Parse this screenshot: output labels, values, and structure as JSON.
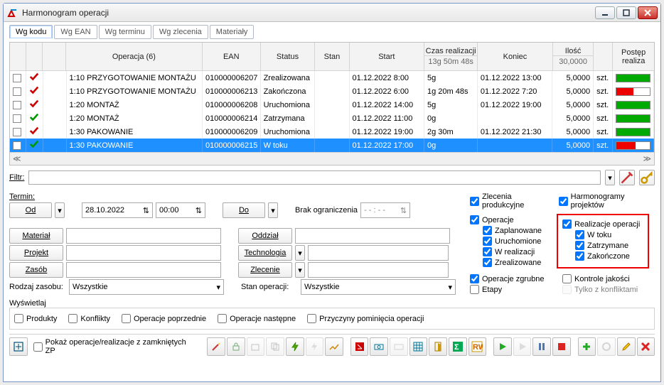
{
  "window": {
    "title": "Harmonogram operacji"
  },
  "tabs": [
    "Wg kodu",
    "Wg EAN",
    "Wg terminu",
    "Wg zlecenia",
    "Materiały"
  ],
  "grid": {
    "columns": {
      "operacja": "Operacja (6)",
      "ean": "EAN",
      "status": "Status",
      "stan": "Stan",
      "start": "Start",
      "czas": "Czas realizacji",
      "czas_sub": "13g 50m 48s",
      "koniec": "Koniec",
      "ilosc": "Ilość",
      "ilosc_sub": "30,0000",
      "postep": "Postęp realiza"
    },
    "rows": [
      {
        "op": "1:10 PRZYGOTOWANIE MONTAŻU",
        "ean": "010000006207",
        "status": "Zrealizowana",
        "stan": "",
        "start": "01.12.2022 8:00",
        "czas": "5g",
        "koniec": "01.12.2022 13:00",
        "il": "5,0000",
        "szt": "szt.",
        "bar": "green",
        "s": "r"
      },
      {
        "op": "1:10 PRZYGOTOWANIE MONTAŻU",
        "ean": "010000006213",
        "status": "Zakończona",
        "stan": "",
        "start": "01.12.2022 6:00",
        "czas": "1g 20m 48s",
        "koniec": "01.12.2022 7:20",
        "il": "5,0000",
        "szt": "szt.",
        "bar": "red",
        "s": "r"
      },
      {
        "op": "1:20 MONTAŻ",
        "ean": "010000006208",
        "status": "Uruchomiona",
        "stan": "",
        "start": "01.12.2022 14:00",
        "czas": "5g",
        "koniec": "01.12.2022 19:00",
        "il": "5,0000",
        "szt": "szt.",
        "bar": "green",
        "s": "r"
      },
      {
        "op": "1:20 MONTAŻ",
        "ean": "010000006214",
        "status": "Zatrzymana",
        "stan": "",
        "start": "01.12.2022 11:00",
        "czas": "0g",
        "koniec": "",
        "il": "5,0000",
        "szt": "szt.",
        "bar": "green",
        "s": "g"
      },
      {
        "op": "1:30 PAKOWANIE",
        "ean": "010000006209",
        "status": "Uruchomiona",
        "stan": "",
        "start": "01.12.2022 19:00",
        "czas": "2g 30m",
        "koniec": "01.12.2022 21:30",
        "il": "5,0000",
        "szt": "szt.",
        "bar": "green",
        "s": "r"
      },
      {
        "op": "1:30 PAKOWANIE",
        "ean": "010000006215",
        "status": "W toku",
        "stan": "",
        "start": "01.12.2022 17:00",
        "czas": "0g",
        "koniec": "",
        "il": "5,0000",
        "szt": "szt.",
        "bar": "red2",
        "s": "g",
        "sel": true
      }
    ]
  },
  "filter": {
    "label": "Filtr:"
  },
  "termin": {
    "label": "Termin:",
    "od": "Od",
    "date": "28.10.2022",
    "time": "00:00",
    "do": "Do",
    "brak": "Brak ograniczenia",
    "empty_time": "- - : - -"
  },
  "form": {
    "material": "Materiał",
    "projekt": "Projekt",
    "zasob": "Zasób",
    "oddzial": "Oddział",
    "technologia": "Technologia",
    "zlecenie": "Zlecenie",
    "rodzaj": "Rodzaj zasobu:",
    "wszystkie": "Wszystkie",
    "stan_op": "Stan operacji:"
  },
  "right": {
    "zlec_prod": "Zlecenia produkcyjne",
    "harm_proj": "Harmonogramy projektów",
    "operacje": "Operacje",
    "zaplanowane": "Zaplanowane",
    "uruchomione": "Uruchomione",
    "wrealizacji": "W realizacji",
    "zrealizowane": "Zrealizowane",
    "realizacje": "Realizacje operacji",
    "wtoku": "W toku",
    "zatrzymane": "Zatrzymane",
    "zakonczone": "Zakończone",
    "op_zgrubne": "Operacje zgrubne",
    "etapy": "Etapy",
    "kontrole": "Kontrole jakości",
    "tylko": "Tylko z konfliktami"
  },
  "display": {
    "label": "Wyświetlaj",
    "produkty": "Produkty",
    "konflikty": "Konflikty",
    "poprzednie": "Operacje poprzednie",
    "nastepne": "Operacje następne",
    "przyczyny": "Przyczyny pominięcia operacji"
  },
  "footer": {
    "pokaz": "Pokaż operacje/realizacje z zamkniętych ZP"
  }
}
